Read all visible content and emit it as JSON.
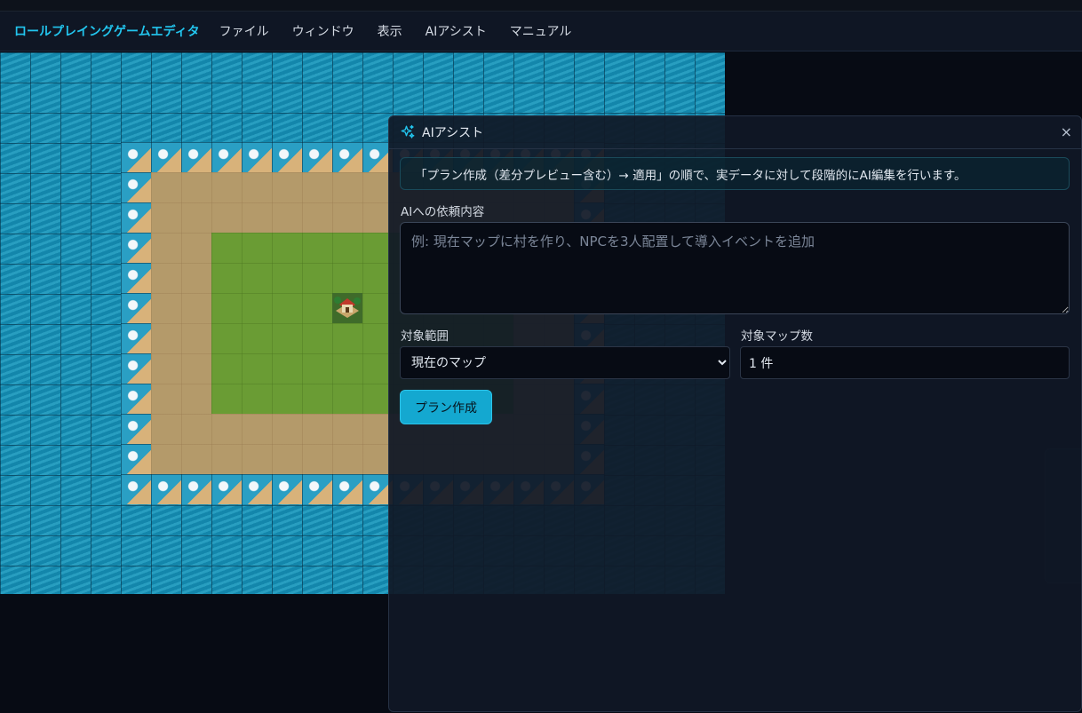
{
  "menubar": {
    "app_title": "ロールプレイングゲームエディタ",
    "items": [
      "ファイル",
      "ウィンドウ",
      "表示",
      "AIアシスト",
      "マニュアル"
    ]
  },
  "dialog": {
    "title": "AIアシスト",
    "title_icon": "sparkles-icon",
    "close_label": "×",
    "info": "「プラン作成（差分プレビュー含む）→ 適用」の順で、実データに対して段階的にAI編集を行います。",
    "request_label": "AIへの依頼内容",
    "request_value": "",
    "request_placeholder": "例: 現在マップに村を作り、NPCを3人配置して導入イベントを追加",
    "scope_label": "対象範囲",
    "scope_selected": "現在のマップ",
    "count_label": "対象マップ数",
    "count_value": "1 件",
    "plan_button": "プラン作成"
  },
  "colors": {
    "accent": "#22c5ee",
    "button": "#14a8d0",
    "background": "#070b14",
    "water": "#1690b5",
    "sand": "#b49a6a",
    "grass": "#6a9c34"
  }
}
